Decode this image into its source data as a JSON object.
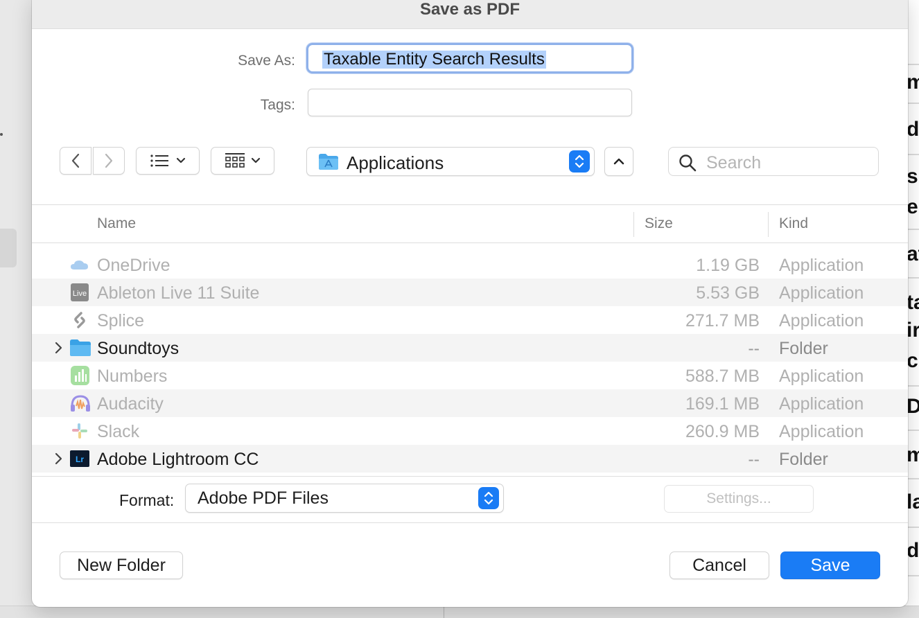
{
  "dialog": {
    "title": "Save as PDF",
    "save_as_label": "Save As:",
    "save_as_value": "Taxable Entity Search Results",
    "tags_label": "Tags:",
    "tags_value": ""
  },
  "toolbar": {
    "back_icon": "chevron-left-icon",
    "forward_icon": "chevron-right-icon",
    "list_view_icon": "list-view-icon",
    "grid_view_icon": "grid-view-icon",
    "location": "Applications",
    "location_icon": "applications-folder-icon",
    "expand_icon": "chevron-up-icon",
    "search_placeholder": "Search",
    "search_icon": "magnifier-icon"
  },
  "columns": {
    "name": "Name",
    "size": "Size",
    "kind": "Kind"
  },
  "files": [
    {
      "name": "OneDrive",
      "size": "1.19 GB",
      "kind": "Application",
      "icon": "onedrive-cloud-icon",
      "enabled": false,
      "expandable": false
    },
    {
      "name": "Ableton Live 11 Suite",
      "size": "5.53 GB",
      "kind": "Application",
      "icon": "ableton-live-icon",
      "enabled": false,
      "expandable": false
    },
    {
      "name": "Splice",
      "size": "271.7 MB",
      "kind": "Application",
      "icon": "splice-icon",
      "enabled": false,
      "expandable": false
    },
    {
      "name": "Soundtoys",
      "size": "--",
      "kind": "Folder",
      "icon": "folder-icon",
      "enabled": true,
      "expandable": true
    },
    {
      "name": "Numbers",
      "size": "588.7 MB",
      "kind": "Application",
      "icon": "numbers-icon",
      "enabled": false,
      "expandable": false
    },
    {
      "name": "Audacity",
      "size": "169.1 MB",
      "kind": "Application",
      "icon": "audacity-icon",
      "enabled": false,
      "expandable": false
    },
    {
      "name": "Slack",
      "size": "260.9 MB",
      "kind": "Application",
      "icon": "slack-icon",
      "enabled": false,
      "expandable": false
    },
    {
      "name": "Adobe Lightroom CC",
      "size": "--",
      "kind": "Folder",
      "icon": "lightroom-folder-icon",
      "enabled": true,
      "expandable": true
    }
  ],
  "format": {
    "label": "Format:",
    "value": "Adobe PDF Files"
  },
  "buttons": {
    "settings": "Settings...",
    "new_folder": "New Folder",
    "cancel": "Cancel",
    "save": "Save"
  },
  "background_app": {
    "fragments": [
      "m",
      "dr",
      "s",
      "e",
      "at",
      "ta",
      "ir",
      "c",
      "D",
      "m",
      "la",
      "dr"
    ]
  },
  "colors": {
    "accent": "#1a7cf5",
    "selection": "#b3d1fb",
    "focus_ring": "#8fb1ea",
    "disabled_text": "#b0b0b0"
  }
}
